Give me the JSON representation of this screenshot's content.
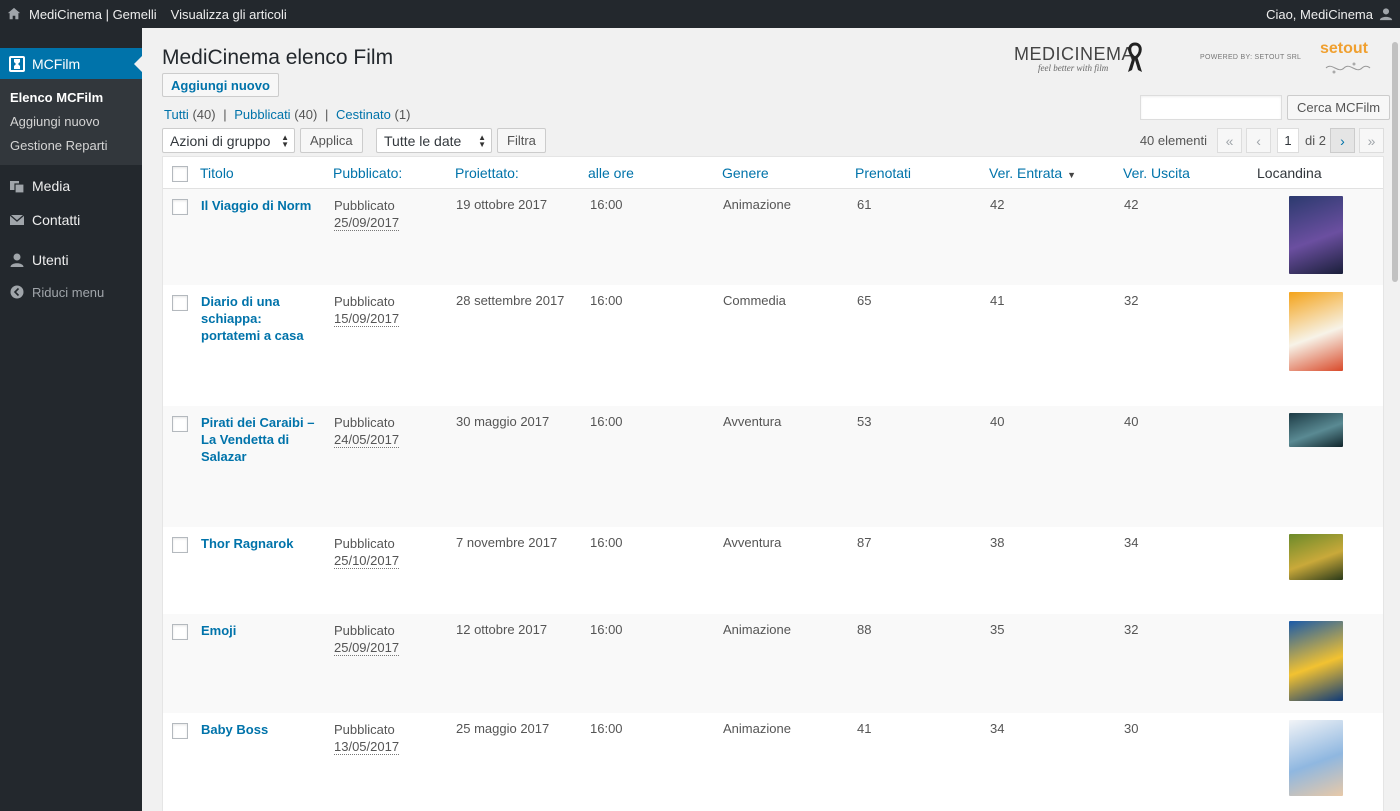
{
  "adminbar": {
    "site_name": "MediCinema | Gemelli",
    "view_posts": "Visualizza gli articoli",
    "greeting": "Ciao, MediCinema"
  },
  "sidebar": {
    "current_menu": "MCFilm",
    "submenu": [
      "Elenco MCFilm",
      "Aggiungi nuovo",
      "Gestione Reparti"
    ],
    "items": [
      "Media",
      "Contatti",
      "Utenti"
    ],
    "collapse": "Riduci menu"
  },
  "page": {
    "title": "MediCinema elenco Film",
    "add_new": "Aggiungi nuovo",
    "logo_text": "MEDICINEMA",
    "logo_tagline": "feel better with film",
    "powered_by": "POWERED BY: SETOUT SRL",
    "setout": "setout"
  },
  "filters": {
    "all_label": "Tutti",
    "all_count": "(40)",
    "published_label": "Pubblicati",
    "published_count": "(40)",
    "trash_label": "Cestinato",
    "trash_count": "(1)"
  },
  "search": {
    "value": "",
    "button": "Cerca MCFilm"
  },
  "tablenav": {
    "bulk_action": "Azioni di gruppo",
    "apply": "Applica",
    "date_filter": "Tutte le date",
    "filter": "Filtra",
    "items_count": "40 elementi",
    "first": "«",
    "prev": "‹",
    "current_page": "1",
    "of_pages": "di 2",
    "next": "›",
    "last": "»"
  },
  "columns": {
    "title": "Titolo",
    "published": "Pubblicato:",
    "projected": "Proiettato:",
    "time": "alle ore",
    "genre": "Genere",
    "booked": "Prenotati",
    "entry": "Ver. Entrata",
    "exit": "Ver. Uscita",
    "poster": "Locandina"
  },
  "rows": [
    {
      "title": "Il Viaggio di Norm",
      "status": "Pubblicato",
      "date": "25/09/2017",
      "projected": "19 ottobre 2017",
      "time": "16:00",
      "genre": "Animazione",
      "booked": "61",
      "entry": "42",
      "exit": "42",
      "poster_colors": [
        "#2b3a6e",
        "#6b4fa0",
        "#1a1f3a"
      ]
    },
    {
      "title": "Diario di una schiappa: portatemi a casa",
      "status": "Pubblicato",
      "date": "15/09/2017",
      "projected": "28 settembre 2017",
      "time": "16:00",
      "genre": "Commedia",
      "booked": "65",
      "entry": "41",
      "exit": "32",
      "poster_colors": [
        "#f4a31a",
        "#f7f3e8",
        "#d94a2a"
      ]
    },
    {
      "title": "Pirati dei Caraibi – La Vendetta di Salazar",
      "status": "Pubblicato",
      "date": "24/05/2017",
      "projected": "30 maggio 2017",
      "time": "16:00",
      "genre": "Avventura",
      "booked": "53",
      "entry": "40",
      "exit": "40",
      "poster_colors": [
        "#1d3b45",
        "#5a8a93",
        "#12262c"
      ]
    },
    {
      "title": "Thor Ragnarok",
      "status": "Pubblicato",
      "date": "25/10/2017",
      "projected": "7 novembre 2017",
      "time": "16:00",
      "genre": "Avventura",
      "booked": "87",
      "entry": "38",
      "exit": "34",
      "poster_colors": [
        "#6b8a2a",
        "#c9a93a",
        "#2a3a1a"
      ]
    },
    {
      "title": "Emoji",
      "status": "Pubblicato",
      "date": "25/09/2017",
      "projected": "12 ottobre 2017",
      "time": "16:00",
      "genre": "Animazione",
      "booked": "88",
      "entry": "35",
      "exit": "32",
      "poster_colors": [
        "#1a5aa8",
        "#f2c231",
        "#0e3a78"
      ]
    },
    {
      "title": "Baby Boss",
      "status": "Pubblicato",
      "date": "13/05/2017",
      "projected": "25 maggio 2017",
      "time": "16:00",
      "genre": "Animazione",
      "booked": "41",
      "entry": "34",
      "exit": "30",
      "poster_colors": [
        "#f2f4f7",
        "#8fb7e0",
        "#e8c9a8"
      ]
    }
  ]
}
